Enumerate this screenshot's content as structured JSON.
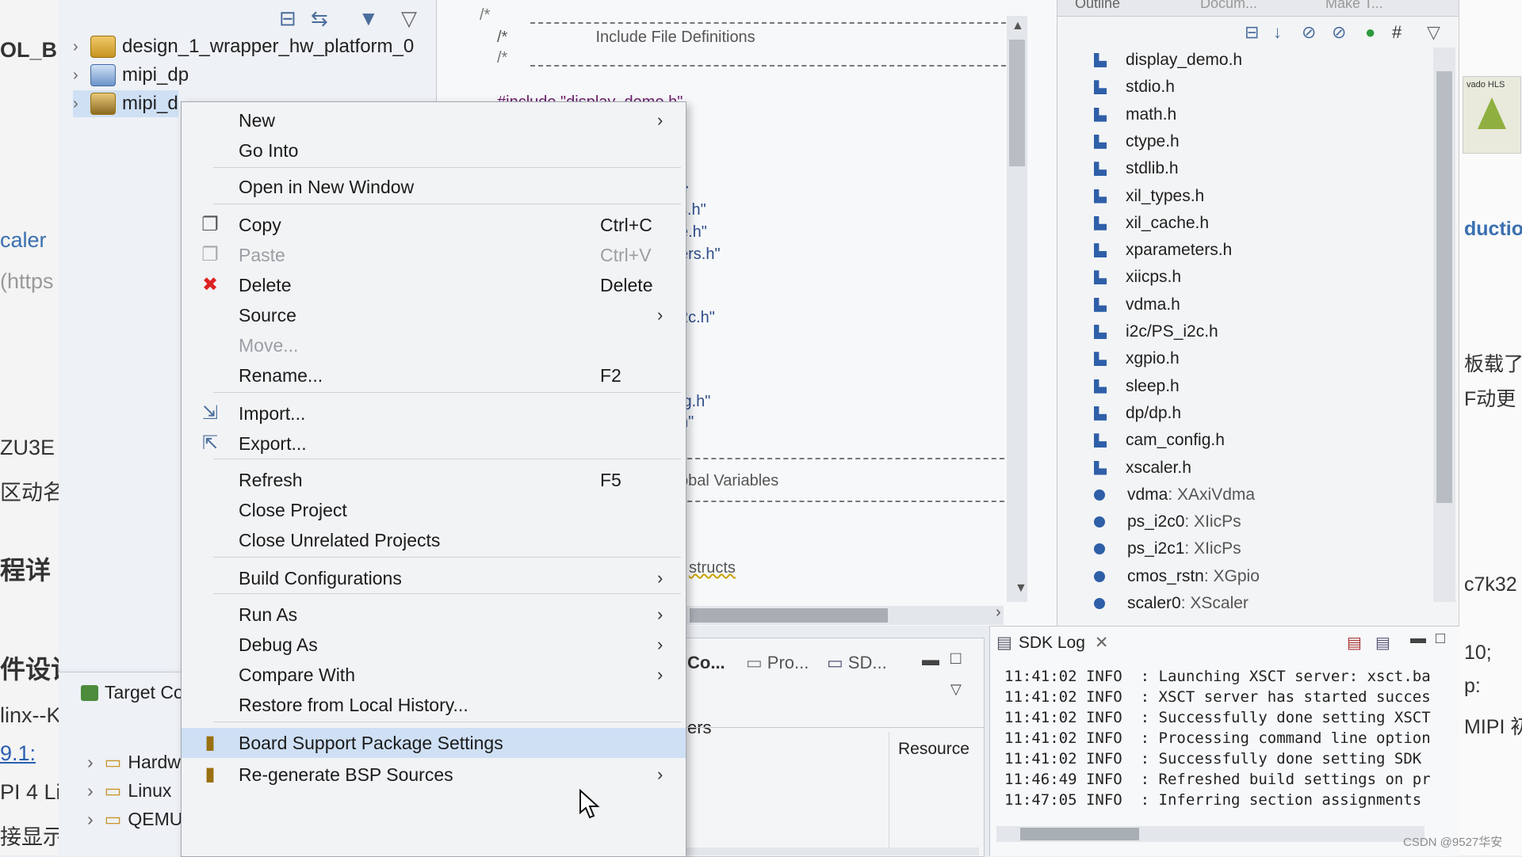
{
  "left_strip": {
    "fragments": [
      "OL_B",
      "caler",
      "(https",
      "ZU3E",
      "区动名",
      "程详",
      "件设计",
      "linx--K",
      "9.1:",
      "PI 4 Li",
      "接显示"
    ]
  },
  "project_explorer": {
    "items": [
      {
        "label": "design_1_wrapper_hw_platform_0"
      },
      {
        "label": "mipi_dp"
      },
      {
        "label": "mipi_d"
      }
    ],
    "tools": [
      "collapse-all-icon",
      "link-editor-icon",
      "filter-icon",
      "view-menu-icon"
    ]
  },
  "target_panel": {
    "title": "Target Co",
    "items": [
      "Hardw",
      "Linux",
      "QEMU"
    ]
  },
  "editor": {
    "code_lines": [
      "/*",
      "/*                    Include File Definitions",
      "/*",
      "#include \"display_demo.h\"",
      ">",
      "s.h\"",
      "e.h\"",
      "ers.h\"",
      "\"",
      "2c.h\"",
      "ig.h\"",
      "h\"",
      "obal Variables",
      "structs"
    ]
  },
  "bottom_panel": {
    "tabs": [
      "Co...",
      "Pro...",
      "SD..."
    ],
    "col_fragment": "ers",
    "resource_header": "Resource"
  },
  "outline": {
    "tabs": [
      "Outline",
      "Docum...",
      "Make T..."
    ],
    "includes": [
      "display_demo.h",
      "stdio.h",
      "math.h",
      "ctype.h",
      "stdlib.h",
      "xil_types.h",
      "xil_cache.h",
      "xparameters.h",
      "xiicps.h",
      "vdma.h",
      "i2c/PS_i2c.h",
      "xgpio.h",
      "sleep.h",
      "dp/dp.h",
      "cam_config.h",
      "xscaler.h"
    ],
    "variables": [
      {
        "name": "vdma",
        "type": " : XAxiVdma"
      },
      {
        "name": "ps_i2c0",
        "type": " : XIicPs"
      },
      {
        "name": "ps_i2c1",
        "type": " : XIicPs"
      },
      {
        "name": "cmos_rstn",
        "type": " : XGpio"
      },
      {
        "name": "scaler0",
        "type": " : XScaler"
      }
    ]
  },
  "sdk_log": {
    "title": "SDK Log",
    "lines": [
      {
        "time": "11:41:02",
        "level": "INFO",
        "msg": ": Launching XSCT server: xsct.ba"
      },
      {
        "time": "11:41:02",
        "level": "INFO",
        "msg": ": XSCT server has started succes"
      },
      {
        "time": "11:41:02",
        "level": "INFO",
        "msg": ": Successfully done setting XSCT"
      },
      {
        "time": "11:41:02",
        "level": "INFO",
        "msg": ": Processing command line option"
      },
      {
        "time": "11:41:02",
        "level": "INFO",
        "msg": ": Successfully done setting SDK"
      },
      {
        "time": "11:46:49",
        "level": "INFO",
        "msg": ": Refreshed build settings on pr"
      },
      {
        "time": "11:47:05",
        "level": "INFO",
        "msg": ": Inferring section assignments"
      }
    ]
  },
  "right_strip": {
    "logo_text": "vado HLS",
    "fragments": [
      "ductio",
      "板载了",
      "F动更",
      "c7k32",
      "10;",
      "p:",
      "MIPI 初"
    ]
  },
  "context_menu": {
    "items": [
      {
        "label": "New",
        "shortcut": "",
        "submenu": true
      },
      {
        "label": "Go Into",
        "shortcut": "",
        "submenu": false
      },
      {
        "label": "Open in New Window",
        "shortcut": "",
        "submenu": false
      },
      {
        "label": "Copy",
        "shortcut": "Ctrl+C",
        "submenu": false
      },
      {
        "label": "Paste",
        "shortcut": "Ctrl+V",
        "submenu": false
      },
      {
        "label": "Delete",
        "shortcut": "Delete",
        "submenu": false
      },
      {
        "label": "Source",
        "shortcut": "",
        "submenu": true
      },
      {
        "label": "Move...",
        "shortcut": "",
        "submenu": false
      },
      {
        "label": "Rename...",
        "shortcut": "F2",
        "submenu": false
      },
      {
        "label": "Import...",
        "shortcut": "",
        "submenu": false
      },
      {
        "label": "Export...",
        "shortcut": "",
        "submenu": false
      },
      {
        "label": "Refresh",
        "shortcut": "F5",
        "submenu": false
      },
      {
        "label": "Close Project",
        "shortcut": "",
        "submenu": false
      },
      {
        "label": "Close Unrelated Projects",
        "shortcut": "",
        "submenu": false
      },
      {
        "label": "Build Configurations",
        "shortcut": "",
        "submenu": true
      },
      {
        "label": "Run As",
        "shortcut": "",
        "submenu": true
      },
      {
        "label": "Debug As",
        "shortcut": "",
        "submenu": true
      },
      {
        "label": "Compare With",
        "shortcut": "",
        "submenu": true
      },
      {
        "label": "Restore from Local History...",
        "shortcut": "",
        "submenu": false
      },
      {
        "label": "Board Support Package Settings",
        "shortcut": "",
        "submenu": false
      },
      {
        "label": "Re-generate BSP Sources",
        "shortcut": "",
        "submenu": true
      }
    ],
    "selected_index": 19,
    "disabled": [
      "Paste",
      "Move..."
    ]
  },
  "watermark": "CSDN @9527华安"
}
